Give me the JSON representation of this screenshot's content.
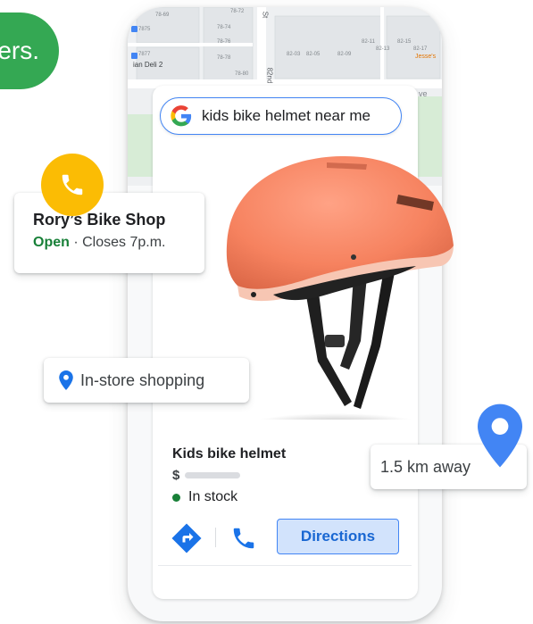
{
  "partial_pill": {
    "text": "ers."
  },
  "map": {
    "street_labels": [
      "78-69",
      "78-72",
      "78-74",
      "78-76",
      "78-77",
      "78-78",
      "78-80",
      "82-03",
      "82-05",
      "82-09",
      "82-11",
      "82-13",
      "82-15",
      "82-17",
      "7875",
      "7877"
    ],
    "street_name_1": "St",
    "street_name_2": "82nd",
    "business_1": "ian Deli 2",
    "business_2": "Jesse's",
    "edge_text": "ve"
  },
  "search": {
    "query": "kids bike helmet near me"
  },
  "store": {
    "name": "Rory’s Bike Shop",
    "open_label": "Open",
    "separator": " · ",
    "hours": "Closes 7p.m."
  },
  "instore": {
    "label": "In-store shopping"
  },
  "distance": {
    "label": "1.5 km away"
  },
  "product": {
    "name": "Kids bike helmet",
    "currency": "$",
    "stock": "In stock"
  },
  "actions": {
    "directions_label": "Directions"
  },
  "colors": {
    "google_blue": "#4285f4",
    "google_green": "#34a853",
    "google_yellow": "#fbbc04",
    "open_green": "#188038",
    "directions_bg": "#d2e3fc",
    "helmet": "#f68b6b"
  },
  "icons": [
    "google-logo-icon",
    "phone-icon",
    "location-pin-icon",
    "directions-icon",
    "call-icon"
  ]
}
